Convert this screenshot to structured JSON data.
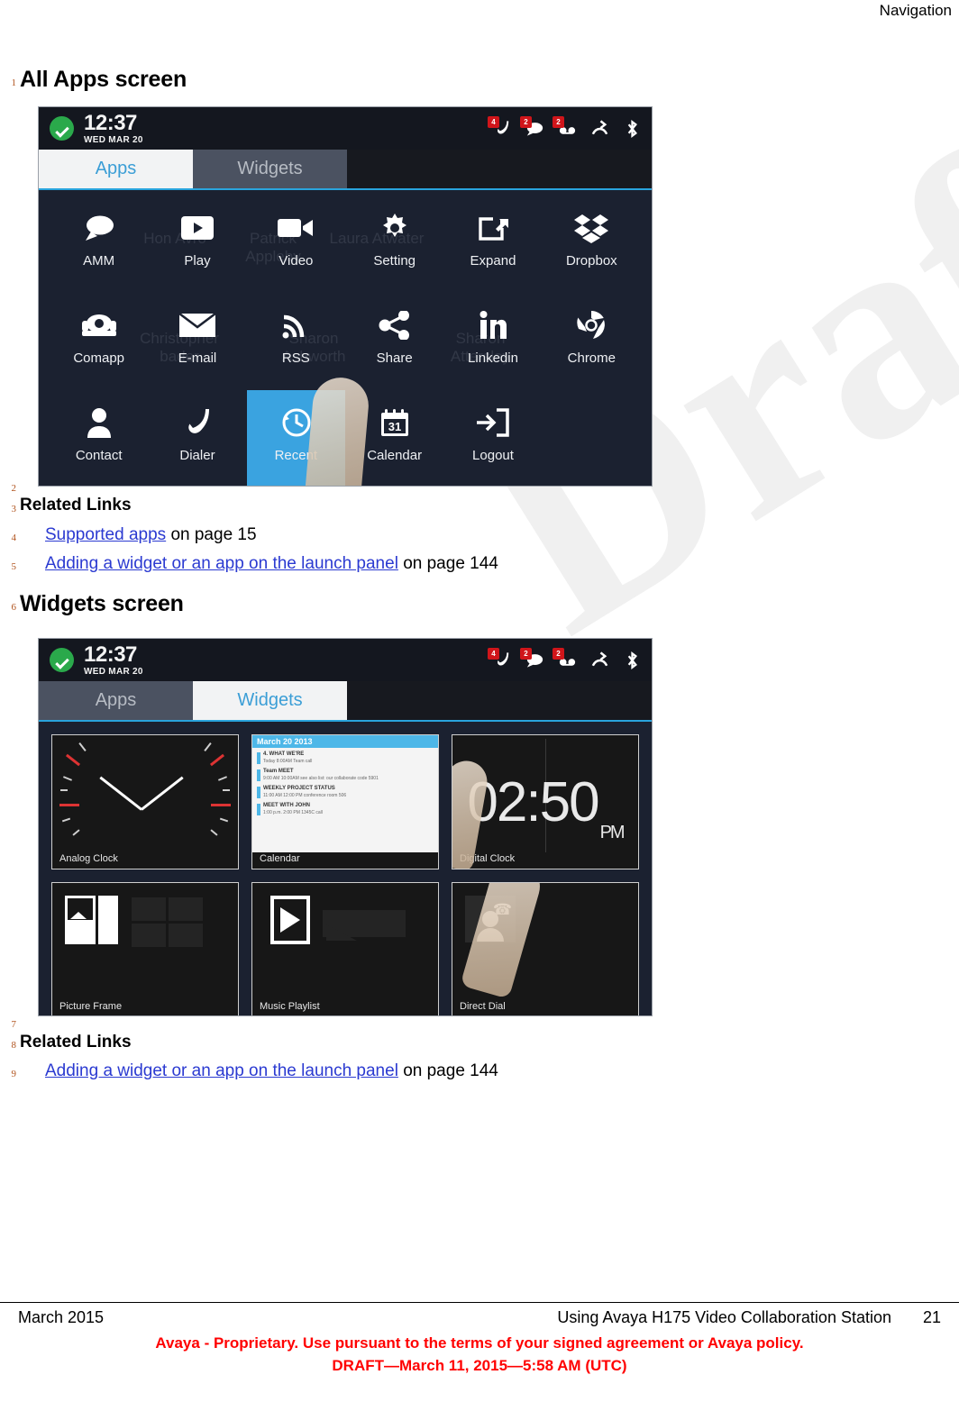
{
  "header": {
    "running_head": "Navigation"
  },
  "line_numbers": [
    "1",
    "2",
    "3",
    "4",
    "5",
    "6",
    "7",
    "8",
    "9"
  ],
  "sections": [
    {
      "heading": "All Apps screen"
    },
    {
      "heading": "Widgets screen"
    }
  ],
  "related_links": {
    "title": "Related Links",
    "group1": [
      {
        "link": "Supported apps",
        "suffix": " on page 15"
      },
      {
        "link": "Adding a widget or an app on the launch panel",
        "suffix": " on page 144"
      }
    ],
    "group2": [
      {
        "link": "Adding a widget or an app on the launch panel",
        "suffix": " on page 144"
      }
    ]
  },
  "watermark": "Draft",
  "phone_apps": {
    "status": {
      "ok_icon": "check-circle-icon",
      "time": "12:37",
      "date": "WED MAR 20",
      "icons": [
        {
          "name": "missed-call-icon",
          "glyph": "✆",
          "badge": "4"
        },
        {
          "name": "message-icon",
          "glyph": "●",
          "badge": "2"
        },
        {
          "name": "voicemail-icon",
          "glyph": "✉",
          "badge": "2"
        },
        {
          "name": "call-forward-icon",
          "glyph": "⇄",
          "badge": ""
        },
        {
          "name": "bluetooth-icon",
          "glyph": "ᛦ",
          "badge": ""
        }
      ]
    },
    "tabs": [
      {
        "label": "Apps",
        "active": true
      },
      {
        "label": "Widgets",
        "active": false
      }
    ],
    "apps": [
      {
        "label": "AMM",
        "icon": "chat-bubble-icon"
      },
      {
        "label": "Play",
        "icon": "play-store-icon"
      },
      {
        "label": "Video",
        "icon": "video-camera-icon"
      },
      {
        "label": "Setting",
        "icon": "gear-icon"
      },
      {
        "label": "Expand",
        "icon": "expand-share-icon"
      },
      {
        "label": "Dropbox",
        "icon": "dropbox-icon"
      },
      {
        "label": "Comapp",
        "icon": "desk-phone-icon"
      },
      {
        "label": "E-mail",
        "icon": "envelope-icon"
      },
      {
        "label": "RSS",
        "icon": "rss-icon"
      },
      {
        "label": "Share",
        "icon": "share-nodes-icon"
      },
      {
        "label": "Linkedin",
        "icon": "linkedin-icon"
      },
      {
        "label": "Chrome",
        "icon": "chrome-icon"
      },
      {
        "label": "Contact",
        "icon": "person-icon"
      },
      {
        "label": "Dialer",
        "icon": "handset-icon"
      },
      {
        "label": "Recent",
        "icon": "clock-history-icon",
        "selected": true
      },
      {
        "label": "Calendar",
        "icon": "calendar-31-icon"
      },
      {
        "label": "Logout",
        "icon": "logout-arrow-icon"
      }
    ],
    "ghost_contacts": [
      "Hon Avro",
      "Laura Atwater",
      "Patrick Appleby",
      "Christopher bader",
      "Sharon Ashworth",
      "Sharon Attersley"
    ]
  },
  "phone_widgets": {
    "status": {
      "ok_icon": "check-circle-icon",
      "time": "12:37",
      "date": "WED MAR 20",
      "icons": [
        {
          "name": "missed-call-icon",
          "glyph": "✆",
          "badge": "4"
        },
        {
          "name": "message-icon",
          "glyph": "●",
          "badge": "2"
        },
        {
          "name": "voicemail-icon",
          "glyph": "✉",
          "badge": "2"
        },
        {
          "name": "call-forward-icon",
          "glyph": "⇄",
          "badge": ""
        },
        {
          "name": "bluetooth-icon",
          "glyph": "ᛦ",
          "badge": ""
        }
      ]
    },
    "tabs": [
      {
        "label": "Apps",
        "active": false
      },
      {
        "label": "Widgets",
        "active": true
      }
    ],
    "widgets": [
      {
        "label": "Analog Clock"
      },
      {
        "label": "Calendar",
        "cal_header": "March 20 2013",
        "events": [
          {
            "title": "4. WHAT WE'RE",
            "detail": "Today  8:00AM\nTeam call"
          },
          {
            "title": "Team MEET",
            "detail": "9:00 AM   10:00AM\nsee also list: our collaborate code 5901"
          },
          {
            "title": "WEEKLY PROJECT STATUS",
            "detail": "11:00 AM   12:00 PM\nconference room 506"
          },
          {
            "title": "MEET WITH JOHN",
            "detail": "1:00 p.m.  2:00 PM\n1345C call"
          }
        ]
      },
      {
        "label": "Digital Clock",
        "time": "02:50",
        "meridiem": "PM"
      },
      {
        "label": "Picture Frame"
      },
      {
        "label": "Music Playlist"
      },
      {
        "label": "Direct Dial"
      }
    ]
  },
  "footer": {
    "left": "March 2015",
    "middle": "Using Avaya H175 Video Collaboration Station",
    "page": "21",
    "red_line1": "Avaya - Proprietary. Use pursuant to the terms of your signed agreement or Avaya policy.",
    "red_line2": "DRAFT—March 11, 2015—5:58 AM (UTC)"
  },
  "colors": {
    "link": "#2b3ad1",
    "linenum": "#b1541f",
    "accent_blue": "#29a4dd",
    "badge_red": "#d0151a",
    "footer_red": "#ff0000"
  }
}
